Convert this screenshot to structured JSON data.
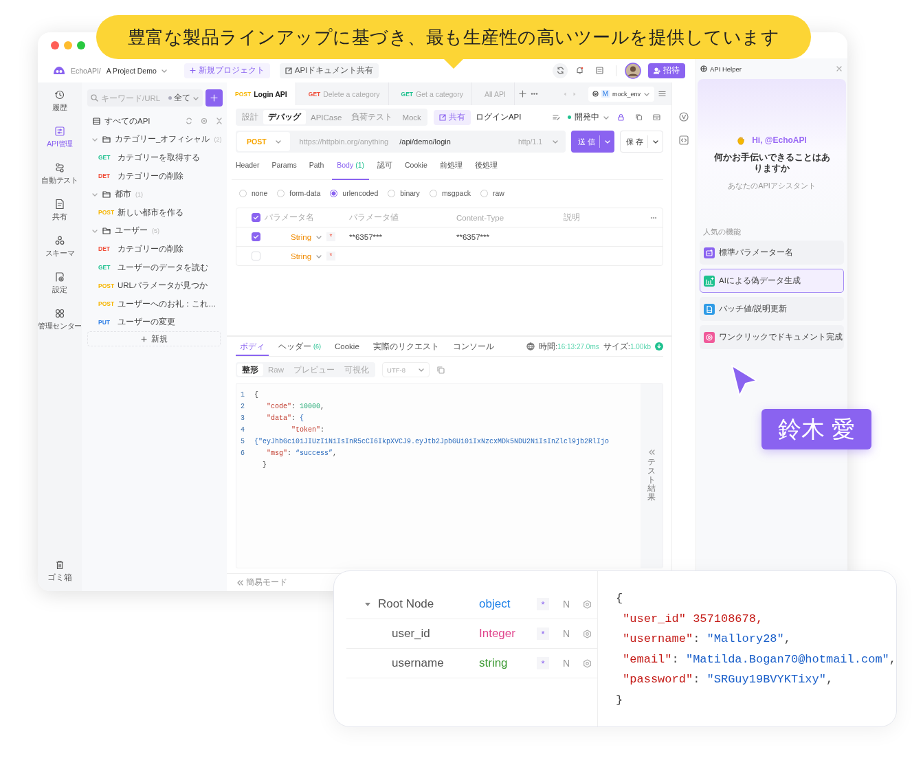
{
  "banner": {
    "text": "豊富な製品ラインアップに基づき、最も生産性の高いツールを提供しています"
  },
  "topbar": {
    "workspace": "EchoAPI/",
    "project": "A Project Demo",
    "new_project": "新規プロジェクト",
    "share_docs": "APIドキュメント共有",
    "invite": "招待"
  },
  "rail": [
    {
      "label": "履歴",
      "selected": false
    },
    {
      "label": "API管理",
      "selected": true
    },
    {
      "label": "自動テスト",
      "selected": false
    },
    {
      "label": "共有",
      "selected": false
    },
    {
      "label": "スキーマ",
      "selected": false
    },
    {
      "label": "設定",
      "selected": false
    },
    {
      "label": "管理センター",
      "selected": false
    }
  ],
  "trash": "ゴミ箱",
  "tree": {
    "search_placeholder": "キーワード/URL",
    "filter": "全て",
    "root": "すべてのAPI",
    "folders": [
      {
        "name": "カテゴリー_オフィシャル",
        "count": "(2)",
        "expanded": true,
        "children": [
          {
            "method": "GET",
            "color": "#1fc18f",
            "name": "カテゴリーを取得する"
          },
          {
            "method": "DET",
            "color": "#f0503c",
            "name": "カテゴリーの削除"
          }
        ]
      },
      {
        "name": "都市",
        "count": "(1)",
        "expanded": true,
        "children": [
          {
            "method": "POST",
            "color": "#f7b500",
            "name": "新しい都市を作る"
          }
        ]
      },
      {
        "name": "ユーザー",
        "count": "(5)",
        "expanded": true,
        "children": [
          {
            "method": "DET",
            "color": "#f0503c",
            "name": "カテゴリーの削除"
          },
          {
            "method": "GET",
            "color": "#1fc18f",
            "name": "ユーザーのデータを読む"
          },
          {
            "method": "POST",
            "color": "#f7b500",
            "name": "URLパラメータが見つか"
          },
          {
            "method": "POST",
            "color": "#f7b500",
            "name": "ユーザーへのお礼：これ…"
          },
          {
            "method": "PUT",
            "color": "#2f7fe6",
            "name": "ユーザーの変更"
          }
        ]
      }
    ],
    "new": "新規"
  },
  "request_tabs": [
    {
      "method": "POST",
      "color": "#f7b500",
      "title": "Login API",
      "selected": true
    },
    {
      "method": "GET",
      "color": "#f0503c",
      "title": "Delete a category",
      "selected": false
    },
    {
      "method": "GET",
      "color": "#1fc18f",
      "title": "Get a category",
      "selected": false
    },
    {
      "title": "All API",
      "selected": false
    }
  ],
  "environment": {
    "badge": "M",
    "name": "mock_env"
  },
  "modes": [
    {
      "label": "設計",
      "selected": false
    },
    {
      "label": "デバッグ",
      "selected": true
    },
    {
      "label": "APICase",
      "selected": false
    },
    {
      "label": "負荷テスト",
      "selected": false
    },
    {
      "label": "Mock",
      "selected": false
    }
  ],
  "share": "共有",
  "api_name": "ログインAPI",
  "status": "開発中",
  "url": {
    "method": "POST",
    "base": "https://httpbin.org/anything",
    "path": "/api/demo/login",
    "protocol": "http/1.1",
    "send": "送 信",
    "save": "保 存"
  },
  "param_tabs": [
    {
      "label": "Header",
      "selected": false
    },
    {
      "label": "Params",
      "selected": false
    },
    {
      "label": "Path",
      "selected": false
    },
    {
      "label": "Body",
      "count": "(1)",
      "selected": true
    },
    {
      "label": "認可",
      "selected": false
    },
    {
      "label": "Cookie",
      "selected": false
    },
    {
      "label": "前処理",
      "selected": false
    },
    {
      "label": "後処理",
      "selected": false
    }
  ],
  "body_types": [
    {
      "label": "none",
      "selected": false
    },
    {
      "label": "form-data",
      "selected": false
    },
    {
      "label": "urlencoded",
      "selected": true
    },
    {
      "label": "binary",
      "selected": false
    },
    {
      "label": "msgpack",
      "selected": false
    },
    {
      "label": "raw",
      "selected": false
    }
  ],
  "params": {
    "header_checked": true,
    "columns": [
      "パラメータ名",
      "パラメータ値",
      "Content-Type",
      "説明"
    ],
    "rows": [
      {
        "checked": true,
        "type": "String",
        "required": "*",
        "value": "**6357***",
        "content_type": "**6357***"
      },
      {
        "checked": false,
        "type": "String",
        "required": "*"
      }
    ]
  },
  "response_tabs": [
    {
      "label": "ボディ",
      "selected": true
    },
    {
      "label": "ヘッダー",
      "count": "(6)",
      "selected": false
    },
    {
      "label": "Cookie",
      "selected": false
    },
    {
      "label": "実際のリクエスト",
      "selected": false
    },
    {
      "label": "コンソール",
      "selected": false
    }
  ],
  "response_meta": {
    "time_label": "時間:",
    "time": "16:13:27.0ms",
    "size_label": "サイズ:",
    "size": "1.00kb"
  },
  "formats": [
    {
      "label": "整形",
      "selected": true
    },
    {
      "label": "Raw",
      "selected": false
    },
    {
      "label": "プレビュー",
      "selected": false
    },
    {
      "label": "可視化",
      "selected": false
    }
  ],
  "encoding": "UTF-8",
  "response_code": [
    {
      "number": "1",
      "tokens": [
        {
          "t": "{",
          "kind": "punct"
        }
      ]
    },
    {
      "number": "2",
      "tokens": [
        {
          "t": "   \"code\"",
          "kind": "key"
        },
        {
          "t": ": ",
          "kind": "punct"
        },
        {
          "t": "10000",
          "kind": "number"
        },
        {
          "t": ",",
          "kind": "punct"
        }
      ]
    },
    {
      "number": "3",
      "tokens": [
        {
          "t": "   \"data\"",
          "kind": "key"
        },
        {
          "t": ": ",
          "kind": "punct"
        },
        {
          "t": "{",
          "kind": "string"
        }
      ]
    },
    {
      "number": "4",
      "tokens": [
        {
          "t": "         \"token\"",
          "kind": "key"
        },
        {
          "t": ":",
          "kind": "punct"
        }
      ]
    },
    {
      "number": "5",
      "tokens": [
        {
          "t": "{\"eyJhbGci0iJIUzI1NiIsInR5cCI6IkpXVCJ9.eyJtb2JpbGUi0iIxNzcxMDk5NDU2NiIsInZlcl9jb2RlIjo",
          "kind": "string"
        }
      ]
    },
    {
      "number": "6",
      "tokens": [
        {
          "t": "   \"msg\"",
          "kind": "key"
        },
        {
          "t": ": ",
          "kind": "punct"
        },
        {
          "t": "“success”",
          "kind": "string"
        },
        {
          "t": ",",
          "kind": "punct"
        }
      ]
    },
    {
      "tokens": [
        {
          "t": "  }",
          "kind": "punct"
        }
      ]
    }
  ],
  "test_results": "テスト結果",
  "simple_mode": "簡易モード",
  "helper": {
    "title": "API Helper",
    "greeting": "Hi, @EchoAPI",
    "question": "何かお手伝いできることはありますか",
    "subtitle": "あなたのAPIアシスタント",
    "section": "人気の機能",
    "features": [
      {
        "label": "標準パラメーター名",
        "color": "#8a63f0",
        "selected": false
      },
      {
        "label": "AIによる偽データ生成",
        "color": "#1fc18f",
        "selected": true
      },
      {
        "label": "バッチ値/説明更新",
        "color": "#2f9be6",
        "selected": false
      },
      {
        "label": "ワンクリックでドキュメント完成",
        "color": "#f05a9a",
        "selected": false
      }
    ]
  },
  "name_badge": "鈴木 愛",
  "schema": {
    "nodes": [
      {
        "name": "Root Node",
        "type": "object",
        "color": "#1a7fe8",
        "required": "*",
        "nullable": "N",
        "expanded": true,
        "children": [
          {
            "name": "user_id",
            "type": "Integer",
            "color": "#e0468d",
            "required": "*",
            "nullable": "N"
          },
          {
            "name": "username",
            "type": "string",
            "color": "#3d9a34",
            "required": "*",
            "nullable": "N"
          }
        ]
      }
    ],
    "code": [
      {
        "tokens": [
          {
            "t": "{",
            "kind": "punct"
          }
        ]
      },
      {
        "tokens": [
          {
            "t": " \"user_id\"",
            "kind": "key"
          },
          {
            "t": " 357108678,",
            "kind": "number"
          }
        ]
      },
      {
        "tokens": [
          {
            "t": " \"username\"",
            "kind": "key"
          },
          {
            "t": ": ",
            "kind": "punct"
          },
          {
            "t": "\"Mallory28\"",
            "kind": "string"
          },
          {
            "t": ",",
            "kind": "punct"
          }
        ]
      },
      {
        "tokens": [
          {
            "t": " \"email\"",
            "kind": "key"
          },
          {
            "t": ": ",
            "kind": "punct"
          },
          {
            "t": "\"Matilda.Bogan70@hotmail.com\"",
            "kind": "string"
          },
          {
            "t": ",",
            "kind": "punct"
          }
        ]
      },
      {
        "tokens": [
          {
            "t": " \"password\"",
            "kind": "key"
          },
          {
            "t": ": ",
            "kind": "punct"
          },
          {
            "t": "\"SRGuy19BVYKTixy\"",
            "kind": "string"
          },
          {
            "t": ",",
            "kind": "punct"
          }
        ]
      },
      {
        "tokens": [
          {
            "t": "}",
            "kind": "punct"
          }
        ]
      }
    ]
  }
}
